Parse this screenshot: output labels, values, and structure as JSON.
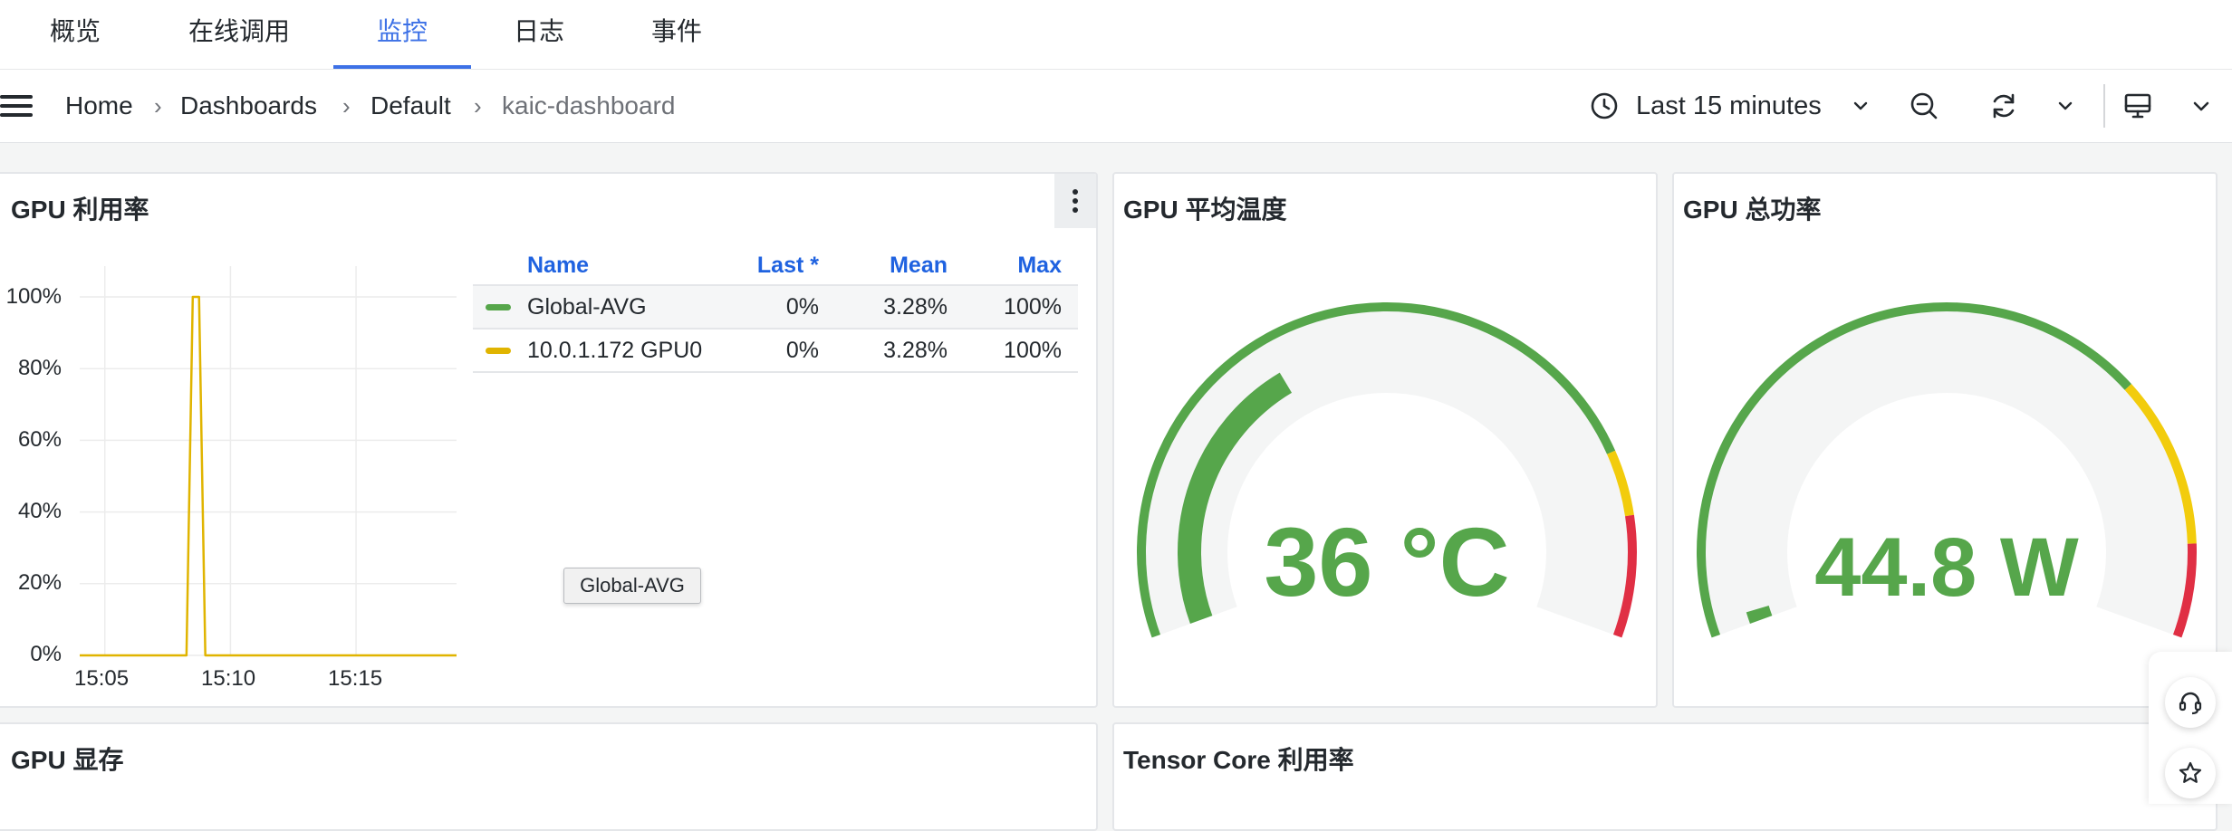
{
  "tabs": [
    {
      "label": "概览",
      "active": false
    },
    {
      "label": "在线调用",
      "active": false
    },
    {
      "label": "监控",
      "active": true
    },
    {
      "label": "日志",
      "active": false
    },
    {
      "label": "事件",
      "active": false
    }
  ],
  "breadcrumb": [
    "Home",
    "Dashboards",
    "Default",
    "kaic-dashboard"
  ],
  "time_range": {
    "label": "Last 15 minutes"
  },
  "icons": {
    "menu": "hamburger-icon",
    "clock": "clock-icon",
    "zoom_out": "zoom-out-icon",
    "refresh": "refresh-icon",
    "tv": "tv-mode-icon",
    "support": "headset-icon",
    "favorite": "star-icon"
  },
  "colors": {
    "accent": "#3d71e6",
    "green": "#56a64b",
    "yellow": "#f2cc0c",
    "red": "#e02f44",
    "link_blue": "#1f62e0"
  },
  "panels": {
    "gpu_util": {
      "title": "GPU 利用率",
      "legend": {
        "headers": {
          "name": "Name",
          "last": "Last *",
          "mean": "Mean",
          "max": "Max"
        },
        "rows": [
          {
            "name": "Global-AVG",
            "last": "0%",
            "mean": "3.28%",
            "max": "100%",
            "color": "#56a64b"
          },
          {
            "name": "10.0.1.172 GPU0",
            "last": "0%",
            "mean": "3.28%",
            "max": "100%",
            "color": "#e0b400"
          }
        ]
      },
      "tooltip": "Global-AVG"
    },
    "gpu_temp": {
      "title": "GPU 平均温度",
      "value": "36 °C"
    },
    "gpu_power": {
      "title": "GPU 总功率",
      "value": "44.8 W"
    },
    "gpu_mem": {
      "title": "GPU 显存"
    },
    "tensor_core": {
      "title": "Tensor Core 利用率"
    }
  },
  "chart_data": [
    {
      "type": "line",
      "title": "GPU 利用率",
      "xlabel": "",
      "ylabel": "",
      "x_ticks": [
        "15:05",
        "15:10",
        "15:15"
      ],
      "y_ticks": [
        "0%",
        "20%",
        "40%",
        "60%",
        "80%",
        "100%"
      ],
      "ylim": [
        0,
        100
      ],
      "grid": true,
      "legend_placement": "right",
      "series": [
        {
          "name": "10.0.1.172 GPU0",
          "color": "#e0b400",
          "points": [
            {
              "x": "15:04:00",
              "y": 0
            },
            {
              "x": "15:08:15",
              "y": 0
            },
            {
              "x": "15:08:30",
              "y": 100
            },
            {
              "x": "15:08:45",
              "y": 100
            },
            {
              "x": "15:09:00",
              "y": 0
            },
            {
              "x": "15:19:00",
              "y": 0
            }
          ]
        }
      ]
    },
    {
      "type": "gauge",
      "title": "GPU 平均温度",
      "value": 36,
      "unit": "°C",
      "min": 0,
      "max": 100,
      "thresholds": [
        {
          "from": 0,
          "to": 80,
          "color": "#56a64b"
        },
        {
          "from": 80,
          "to": 87,
          "color": "#f2cc0c"
        },
        {
          "from": 87,
          "to": 100,
          "color": "#e02f44"
        }
      ]
    },
    {
      "type": "gauge",
      "title": "GPU 总功率",
      "value": 44.8,
      "unit": "W",
      "min": 0,
      "max": 3000,
      "thresholds": [
        {
          "from": 0,
          "to": 2150,
          "color": "#56a64b"
        },
        {
          "from": 2150,
          "to": 2700,
          "color": "#f2cc0c"
        },
        {
          "from": 2700,
          "to": 3000,
          "color": "#e02f44"
        }
      ]
    }
  ]
}
